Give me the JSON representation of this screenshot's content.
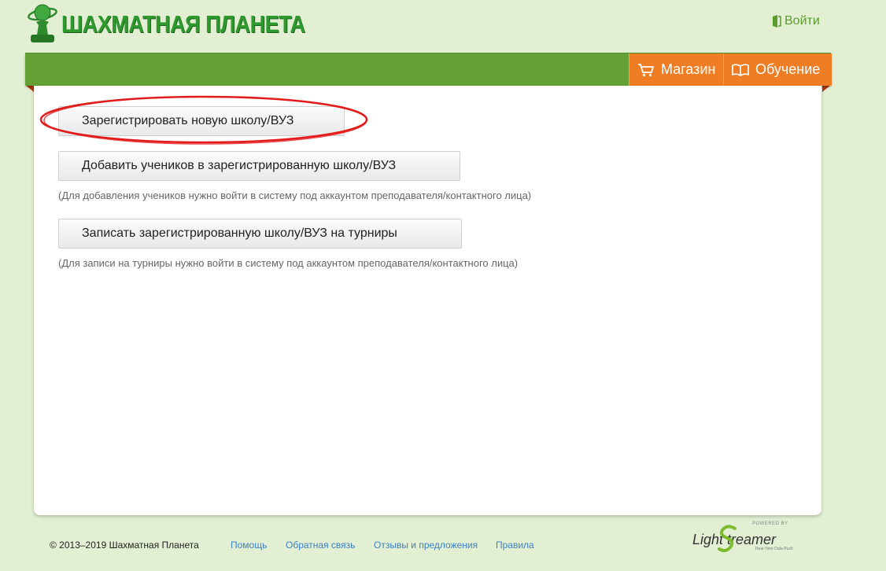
{
  "header": {
    "logo_text": "ШАХМАТНАЯ ПЛАНЕТА",
    "login_label": "Войти"
  },
  "nav": {
    "shop_label": "Магазин",
    "learn_label": "Обучение"
  },
  "main": {
    "register_school_label": "Зарегистрировать новую школу/ВУЗ",
    "add_students_label": "Добавить учеников в зарегистрированную школу/ВУЗ",
    "add_students_note": "(Для добавления учеников нужно войти в систему под аккаунтом преподавателя/контактного лица)",
    "enroll_tournaments_label": "Записать зарегистрированную школу/ВУЗ на турниры",
    "enroll_tournaments_note": "(Для записи на турниры нужно войти в систему под аккаунтом преподавателя/контактного лица)"
  },
  "footer": {
    "copyright": "© 2013–2019 Шахматная Планета",
    "links": [
      "Помощь",
      "Обратная связь",
      "Отзывы и предложения",
      "Правила"
    ],
    "powered_by": "POWERED BY",
    "lightstreamer_name": "Light  treamer",
    "lightstreamer_tagline": "Real-Time Data Push"
  },
  "colors": {
    "page_bg": "#e2efd3",
    "nav_green": "#64a036",
    "nav_orange": "#ee7d24",
    "logo_green": "#2e9a2e",
    "link_blue": "#3b7fc4",
    "annotation_red": "#e21b1b"
  },
  "icons": {
    "logo": "chess-pawn-planet-icon",
    "login": "login-door-icon",
    "shop": "cart-icon",
    "learn": "book-icon"
  }
}
